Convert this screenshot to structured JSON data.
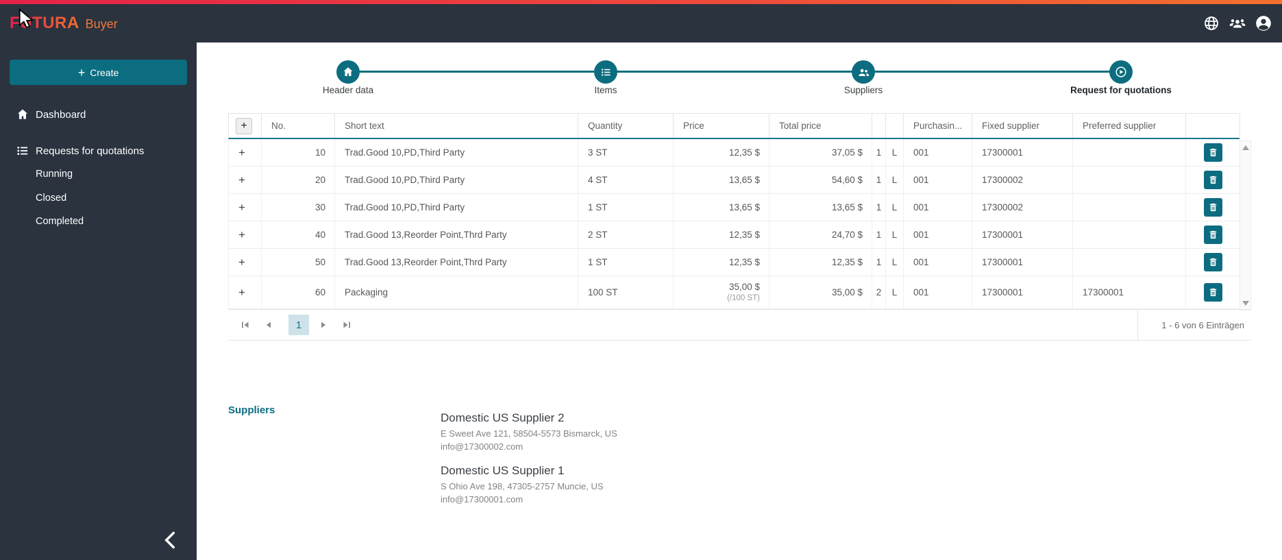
{
  "app": {
    "brand": "FUTURA",
    "product": "Buyer"
  },
  "sidebar": {
    "create_label": "Create",
    "items": [
      {
        "label": "Dashboard"
      },
      {
        "label": "Requests for quotations"
      }
    ],
    "subitems": [
      {
        "label": "Running"
      },
      {
        "label": "Closed"
      },
      {
        "label": "Completed"
      }
    ]
  },
  "stepper": {
    "steps": [
      {
        "label": "Header data"
      },
      {
        "label": "Items"
      },
      {
        "label": "Suppliers"
      },
      {
        "label": "Request for quotations",
        "active": true
      }
    ]
  },
  "table": {
    "add_button_label": "+",
    "expand_label": "+",
    "columns": [
      "",
      "No.",
      "Short text",
      "Quantity",
      "Price",
      "Total price",
      "",
      "",
      "Purchasin...",
      "Fixed supplier",
      "Preferred supplier",
      ""
    ],
    "rows": [
      {
        "no": "10",
        "short_text": "Trad.Good 10,PD,Third Party",
        "quantity": "3 ST",
        "price": "12,35 $",
        "price_unit": "",
        "total_price": "37,05 $",
        "col1": "1",
        "col2": "L",
        "purchasing": "001",
        "fixed_supplier": "17300001",
        "preferred_supplier": ""
      },
      {
        "no": "20",
        "short_text": "Trad.Good 10,PD,Third Party",
        "quantity": "4 ST",
        "price": "13,65 $",
        "price_unit": "",
        "total_price": "54,60 $",
        "col1": "1",
        "col2": "L",
        "purchasing": "001",
        "fixed_supplier": "17300002",
        "preferred_supplier": ""
      },
      {
        "no": "30",
        "short_text": "Trad.Good 10,PD,Third Party",
        "quantity": "1 ST",
        "price": "13,65 $",
        "price_unit": "",
        "total_price": "13,65 $",
        "col1": "1",
        "col2": "L",
        "purchasing": "001",
        "fixed_supplier": "17300002",
        "preferred_supplier": ""
      },
      {
        "no": "40",
        "short_text": "Trad.Good 13,Reorder Point,Thrd Party",
        "quantity": "2 ST",
        "price": "12,35 $",
        "price_unit": "",
        "total_price": "24,70 $",
        "col1": "1",
        "col2": "L",
        "purchasing": "001",
        "fixed_supplier": "17300001",
        "preferred_supplier": ""
      },
      {
        "no": "50",
        "short_text": "Trad.Good 13,Reorder Point,Thrd Party",
        "quantity": "1 ST",
        "price": "12,35 $",
        "price_unit": "",
        "total_price": "12,35 $",
        "col1": "1",
        "col2": "L",
        "purchasing": "001",
        "fixed_supplier": "17300001",
        "preferred_supplier": ""
      },
      {
        "no": "60",
        "short_text": "Packaging",
        "quantity": "100 ST",
        "price": "35,00 $",
        "price_unit": "(/100 ST)",
        "total_price": "35,00 $",
        "col1": "2",
        "col2": "L",
        "purchasing": "001",
        "fixed_supplier": "17300001",
        "preferred_supplier": "17300001"
      }
    ],
    "pagination": {
      "page": "1",
      "entries_text": "1 - 6 von 6 Einträgen"
    }
  },
  "suppliers_section": {
    "title": "Suppliers",
    "suppliers": [
      {
        "name": "Domestic US Supplier 2",
        "address": "E Sweet Ave 121, 58504-5573 Bismarck, US",
        "email": "info@17300002.com"
      },
      {
        "name": "Domestic US Supplier 1",
        "address": "S Ohio Ave 198, 47305-2757 Muncie, US",
        "email": "info@17300001.com"
      }
    ]
  },
  "colors": {
    "accent": "#0c6d80",
    "dark": "#2a333e",
    "topbar_gradient_start": "#e52248",
    "topbar_gradient_end": "#f3702e",
    "active_page_bg": "#cfe2ea"
  }
}
